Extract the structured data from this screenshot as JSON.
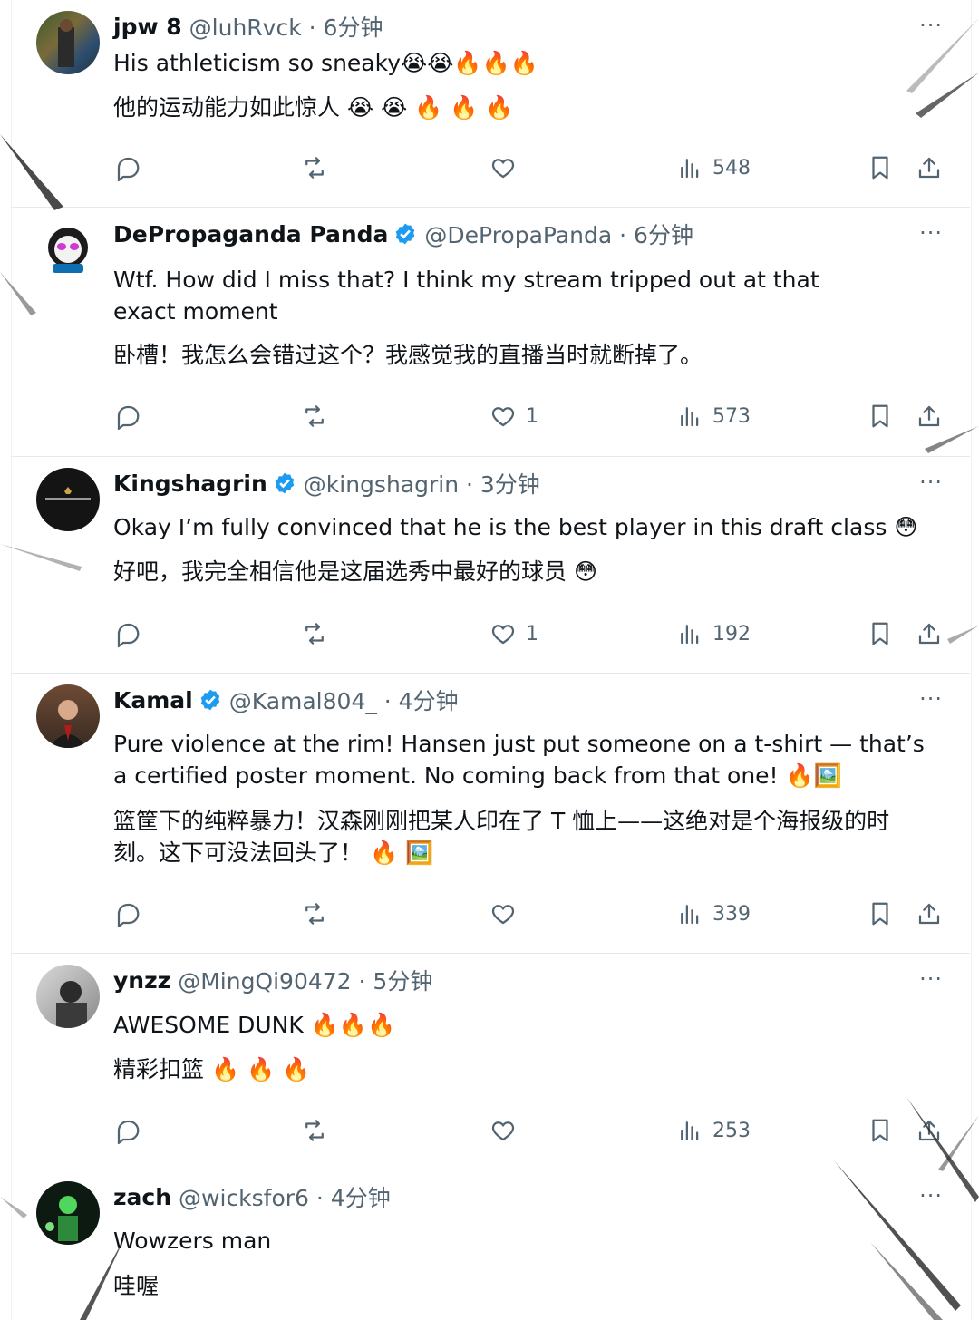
{
  "colors": {
    "verified": "#1d9bf0",
    "icon_gray": "#536471",
    "text": "#0f1419"
  },
  "tweets": [
    {
      "name": "jpw 8",
      "handle": "@luhRvck · 6分钟",
      "text": "His athleticism so sneaky😭😭🔥🔥🔥",
      "translation": "他的运动能力如此惊人 😭 😭 🔥 🔥 🔥",
      "likes": "",
      "views": "548",
      "more": "···"
    },
    {
      "name": "DePropaganda Panda",
      "handle": "@DePropaPanda · 6分钟",
      "text": "Wtf. How did I miss that? I think my stream tripped out at that exact moment",
      "translation": "卧槽！我怎么会错过这个？我感觉我的直播当时就断掉了。",
      "likes": "1",
      "views": "573",
      "more": "···"
    },
    {
      "name": "Kingshagrin",
      "handle": "@kingshagrin · 3分钟",
      "text": "Okay I’m fully convinced that he is the best player in this draft class 😳",
      "translation": "好吧，我完全相信他是这届选秀中最好的球员 😳",
      "likes": "1",
      "views": "192",
      "more": "···"
    },
    {
      "name": "Kamal",
      "handle": "@Kamal804_ · 4分钟",
      "text": "Pure violence at the rim! Hansen just put someone on a t-shirt — that’s a certified poster moment. No coming back from that one! 🔥🖼️",
      "translation": "篮筐下的纯粹暴力！汉森刚刚把某人印在了 T 恤上——这绝对是个海报级的时刻。这下可没法回头了！ 🔥 🖼️",
      "likes": "",
      "views": "339",
      "more": "···"
    },
    {
      "name": "ynzz",
      "handle": "@MingQi90472 · 5分钟",
      "text": "AWESOME DUNK 🔥🔥🔥",
      "translation": "精彩扣篮 🔥 🔥 🔥",
      "likes": "",
      "views": "253",
      "more": "···"
    },
    {
      "name": "zach",
      "handle": "@wicksfor6 · 4分钟",
      "text": "Wowzers man",
      "translation": "哇喔",
      "likes": "",
      "views": "",
      "more": "···"
    }
  ]
}
